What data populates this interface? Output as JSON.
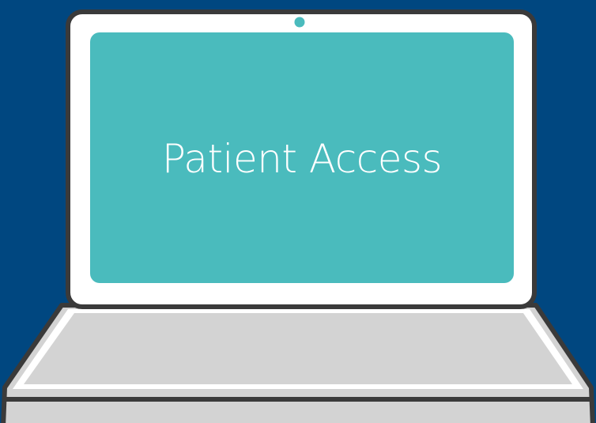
{
  "screen": {
    "title": "Patient Access"
  },
  "colors": {
    "background": "#004780",
    "screen": "#4abbbd",
    "bezel": "#ffffff",
    "outline": "#3a3a3a",
    "keyboard": "#d3d3d3",
    "camera": "#4abbbd"
  },
  "icons": {
    "laptop": "laptop-icon",
    "camera": "webcam-icon"
  }
}
